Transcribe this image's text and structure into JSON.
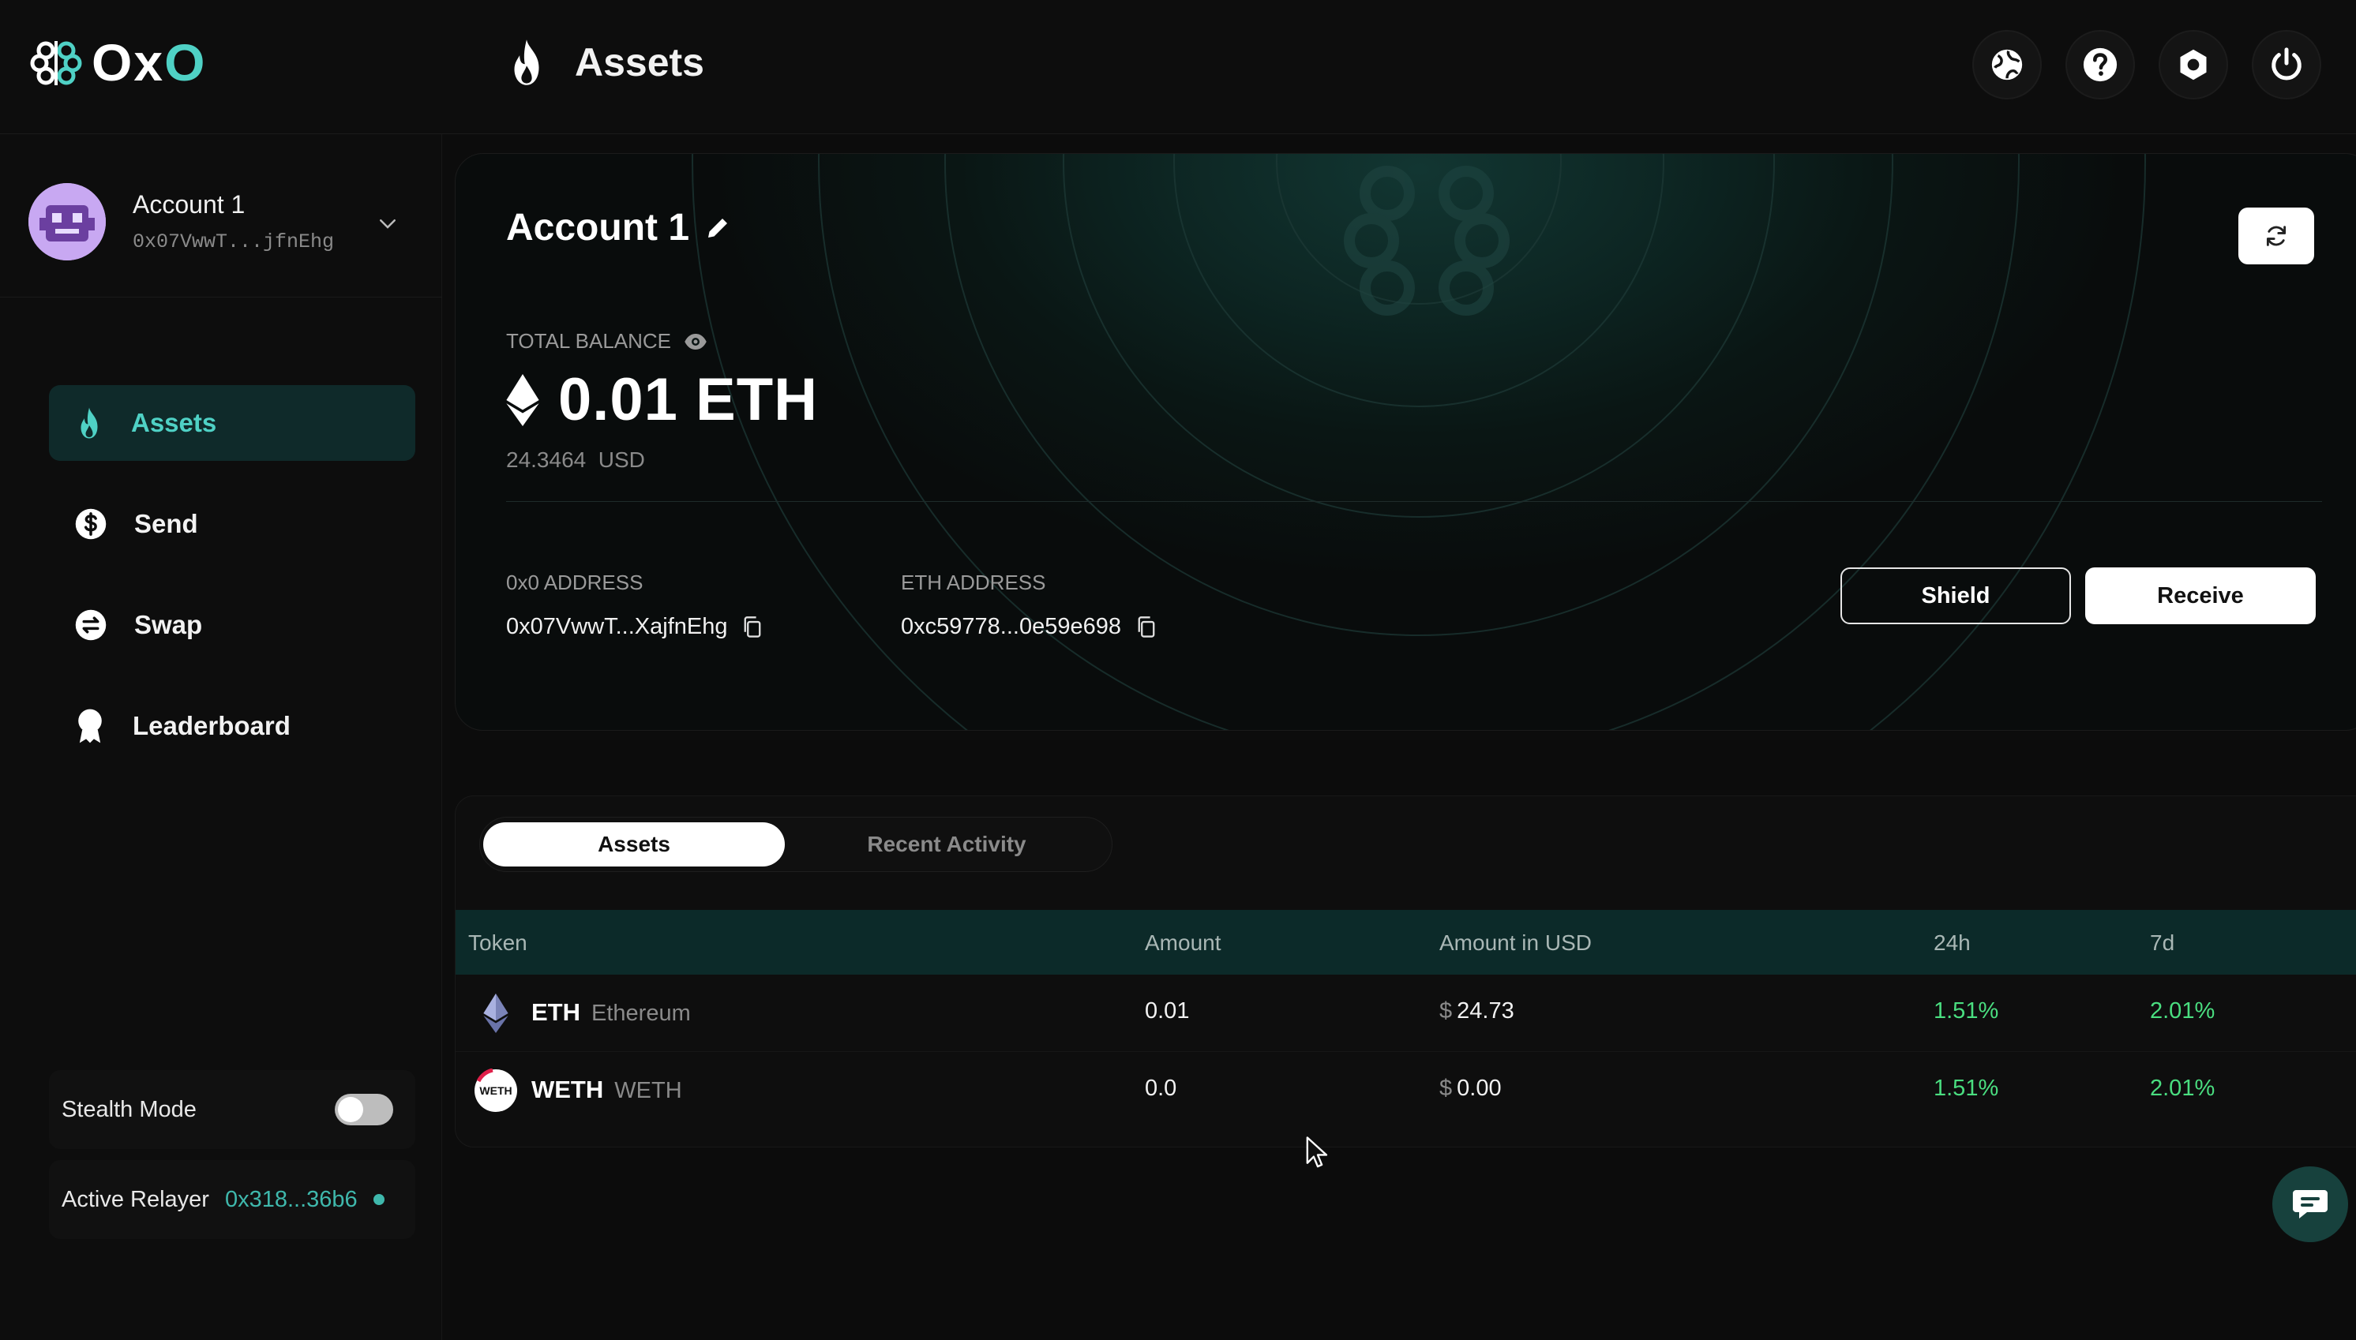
{
  "app": {
    "logo_text_a": "O",
    "logo_text_x": "x",
    "logo_text_b": "O",
    "page_title": "Assets"
  },
  "top_icons": [
    "globe-icon",
    "help-icon",
    "hexagon-settings-icon",
    "power-icon"
  ],
  "sidebar": {
    "account": {
      "name": "Account 1",
      "address": "0x07VwwT...jfnEhg"
    },
    "nav": [
      {
        "label": "Assets",
        "icon": "flame-icon",
        "active": true
      },
      {
        "label": "Send",
        "icon": "dollar-circle-icon",
        "active": false
      },
      {
        "label": "Swap",
        "icon": "swap-circle-icon",
        "active": false
      },
      {
        "label": "Leaderboard",
        "icon": "medal-icon",
        "active": false
      }
    ],
    "stealth_mode": {
      "label": "Stealth Mode",
      "enabled": false
    },
    "relayer": {
      "label": "Active Relayer",
      "value": "0x318...36b6"
    }
  },
  "hero": {
    "account_name": "Account 1",
    "total_balance_label": "TOTAL BALANCE",
    "balance": "0.01 ETH",
    "usd_value": "24.3464",
    "usd_unit": "USD",
    "oxo_address_label": "0x0 ADDRESS",
    "oxo_address": "0x07VwwT...XajfnEhg",
    "eth_address_label": "ETH ADDRESS",
    "eth_address": "0xc59778...0e59e698",
    "shield_label": "Shield",
    "receive_label": "Receive"
  },
  "tabs": [
    {
      "label": "Assets",
      "active": true
    },
    {
      "label": "Recent Activity",
      "active": false
    }
  ],
  "table": {
    "columns": [
      "Token",
      "Amount",
      "Amount in USD",
      "24h",
      "7d"
    ],
    "rows": [
      {
        "symbol": "ETH",
        "name": "Ethereum",
        "amount": "0.01",
        "currency": "$",
        "usd": "24.73",
        "change_24h": "1.51%",
        "change_7d": "2.01%"
      },
      {
        "symbol": "WETH",
        "name": "WETH",
        "amount": "0.0",
        "currency": "$",
        "usd": "0.00",
        "change_24h": "1.51%",
        "change_7d": "2.01%"
      }
    ]
  },
  "colors": {
    "accent": "#4fd1c5",
    "positive": "#4ade80",
    "background": "#0c0c0c"
  }
}
